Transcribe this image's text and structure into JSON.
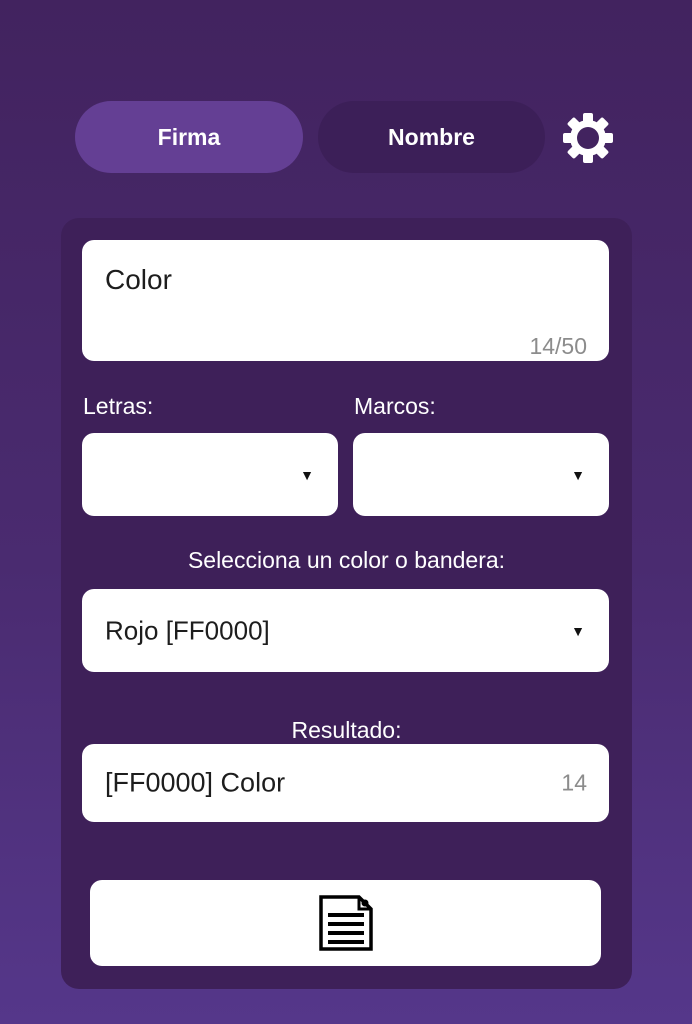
{
  "tabs": [
    {
      "label": "Firma",
      "active": true
    },
    {
      "label": "Nombre",
      "active": false
    }
  ],
  "settings_icon": "gear-icon",
  "text_input": {
    "value": "Color",
    "counter": "14/50"
  },
  "letras": {
    "label": "Letras:",
    "value": ""
  },
  "marcos": {
    "label": "Marcos:",
    "value": ""
  },
  "color_select": {
    "label": "Selecciona un color o bandera:",
    "value": "Rojo [FF0000]"
  },
  "result": {
    "label": "Resultado:",
    "value": "[FF0000] Color",
    "counter": "14"
  },
  "copy_button": {
    "icon": "document-icon"
  },
  "colors": {
    "background": "#4a2b70",
    "panel": "#3e2059",
    "tab_active": "#643f94",
    "tab_inactive": "#3c1f58",
    "field": "#ffffff",
    "text": "#1d1d1d",
    "counter": "#8c8c8c"
  }
}
